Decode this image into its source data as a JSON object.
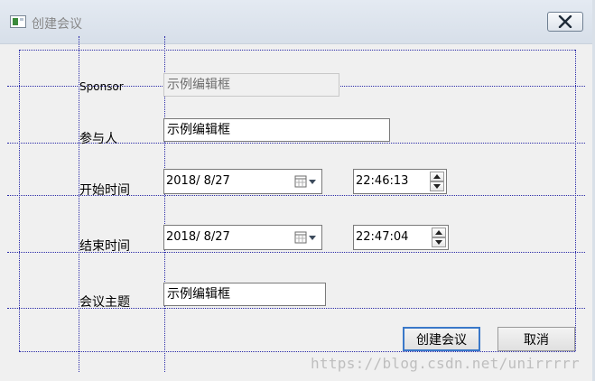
{
  "window": {
    "title": "创建会议",
    "icons": {
      "app": "window-app-icon",
      "close": "close-x-icon"
    }
  },
  "form": {
    "sponsor": {
      "label": "Sponsor",
      "value": "示例编辑框"
    },
    "participants": {
      "label": "参与人",
      "value": "示例编辑框"
    },
    "start_time": {
      "label": "开始时间",
      "date": "2018/  8/27",
      "time": "22:46:13"
    },
    "end_time": {
      "label": "结束时间",
      "date": "2018/  8/27",
      "time": "22:47:04"
    },
    "subject": {
      "label": "会议主题",
      "value": "示例编辑框"
    }
  },
  "buttons": {
    "create": "创建会议",
    "cancel": "取消"
  },
  "watermark": "https://blog.csdn.net/unirrrrr",
  "colors": {
    "guide_lines": "#2a2aa8",
    "default_button_border": "#3a78c9",
    "title_text": "#888888"
  }
}
